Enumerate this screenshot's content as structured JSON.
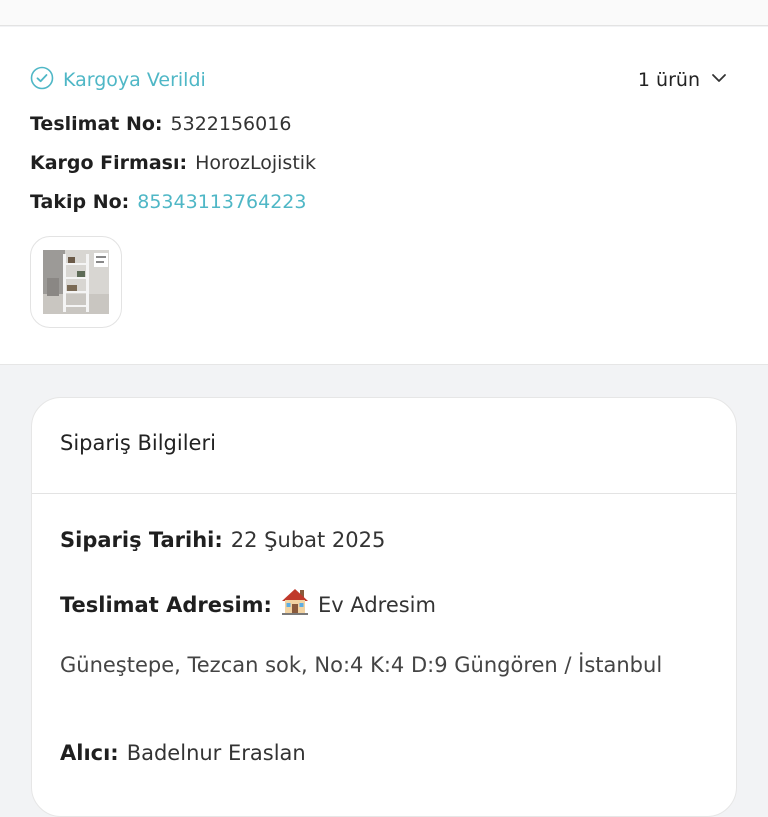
{
  "shipment": {
    "status": "Kargoya Verildi",
    "item_count": "1 ürün",
    "delivery_no_label": "Teslimat No:",
    "delivery_no": "5322156016",
    "carrier_label": "Kargo Firması:",
    "carrier": "HorozLojistik",
    "tracking_label": "Takip No:",
    "tracking_no": "85343113764223",
    "icons": {
      "status": "check-circle-icon",
      "expand": "chevron-down-icon"
    }
  },
  "order": {
    "title": "Sipariş Bilgileri",
    "date_label": "Sipariş Tarihi:",
    "date": "22 Şubat 2025",
    "address_label": "Teslimat Adresim:",
    "address_name": "Ev Adresim",
    "address_text": "Güneştepe, Tezcan sok, No:4  K:4 D:9 Güngören / İstanbul",
    "recipient_label": "Alıcı:",
    "recipient": "Badelnur Eraslan",
    "icons": {
      "address": "house-icon"
    }
  },
  "colors": {
    "accent": "#4fb7c6",
    "background": "#f2f3f5",
    "card": "#ffffff"
  }
}
